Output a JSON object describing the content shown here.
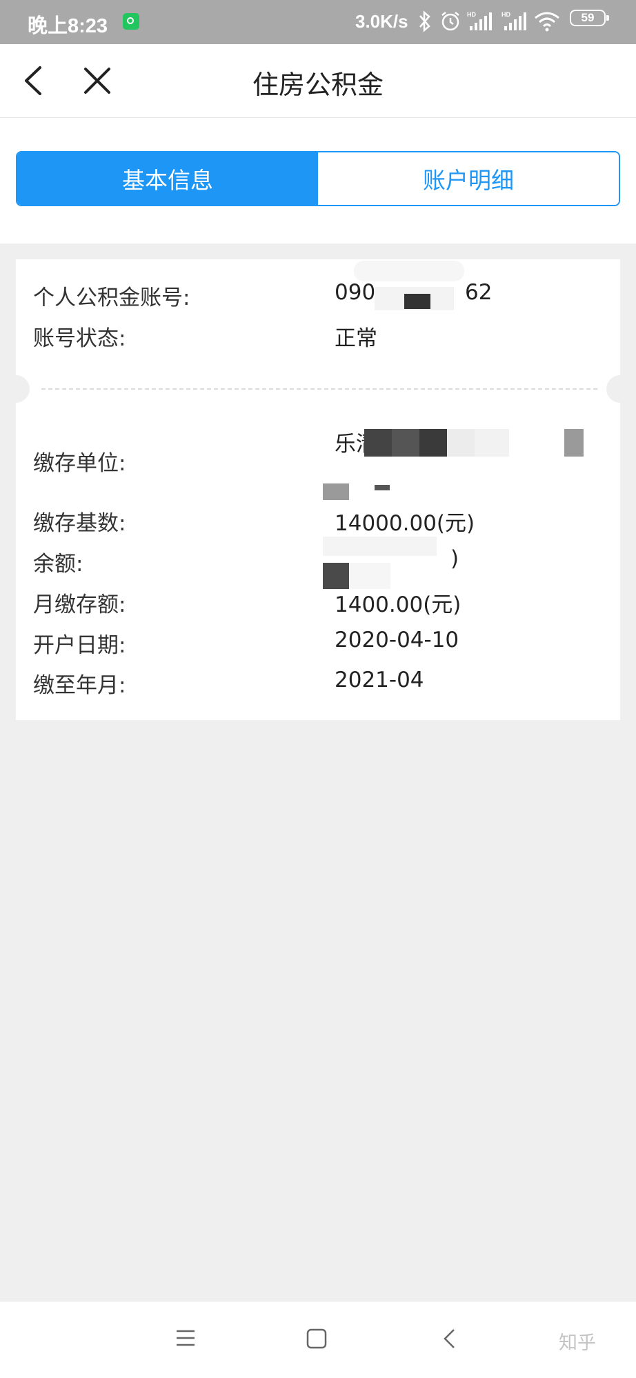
{
  "status_bar": {
    "time": "晚上8:23",
    "net_speed": "3.0K/s",
    "battery": "59"
  },
  "header": {
    "title": "住房公积金"
  },
  "tabs": [
    {
      "label": "基本信息",
      "active": true
    },
    {
      "label": "账户明细",
      "active": false
    }
  ],
  "info": {
    "account_no": {
      "label": "个人公积金账号:",
      "value": "090",
      "value_tail": "62"
    },
    "status": {
      "label": "账号状态:",
      "value": "正常"
    },
    "unit": {
      "label": "缴存单位:",
      "value": "乐清"
    },
    "base": {
      "label": "缴存基数:",
      "value": "14000.00(元)"
    },
    "balance": {
      "label": "余额:",
      "value_tail": ")"
    },
    "monthly": {
      "label": "月缴存额:",
      "value": "1400.00(元)"
    },
    "open_date": {
      "label": "开户日期:",
      "value": "2020-04-10"
    },
    "paid_until": {
      "label": "缴至年月:",
      "value": "2021-04"
    }
  },
  "watermark": "知乎"
}
